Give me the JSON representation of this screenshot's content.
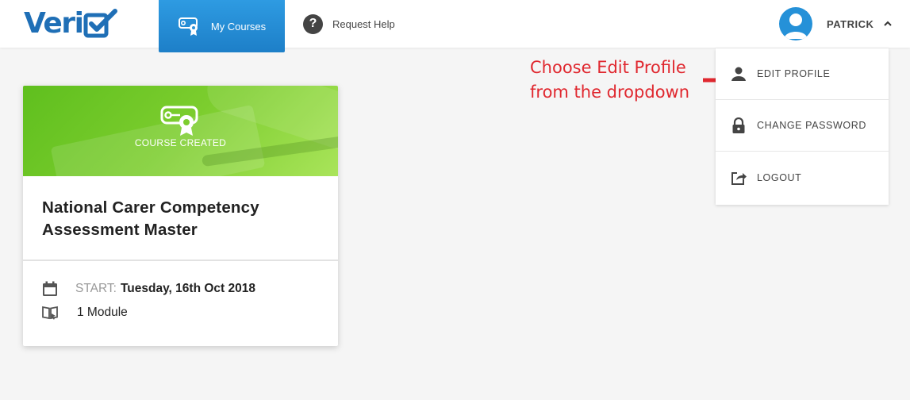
{
  "header": {
    "logo_text": "Veri",
    "nav": {
      "my_courses_label": "My Courses",
      "request_help_label": "Request Help"
    },
    "user": {
      "name": "PATRICK"
    }
  },
  "dropdown": {
    "items": [
      {
        "label": "EDIT PROFILE",
        "icon": "user-icon"
      },
      {
        "label": "CHANGE PASSWORD",
        "icon": "lock-icon"
      },
      {
        "label": "LOGOUT",
        "icon": "logout-icon"
      }
    ]
  },
  "annotation": {
    "text": "Choose Edit Profile\nfrom the dropdown",
    "color": "#e0282f"
  },
  "course_card": {
    "banner_label": "COURSE CREATED",
    "title": "National Carer Competency Assessment Master",
    "start_label": "START:",
    "start_date": "Tuesday, 16th Oct 2018",
    "modules": "1 Module"
  },
  "colors": {
    "brand_blue": "#1f6fb6",
    "nav_active": "#2e9be2",
    "banner_green": "#7ccd2e"
  }
}
